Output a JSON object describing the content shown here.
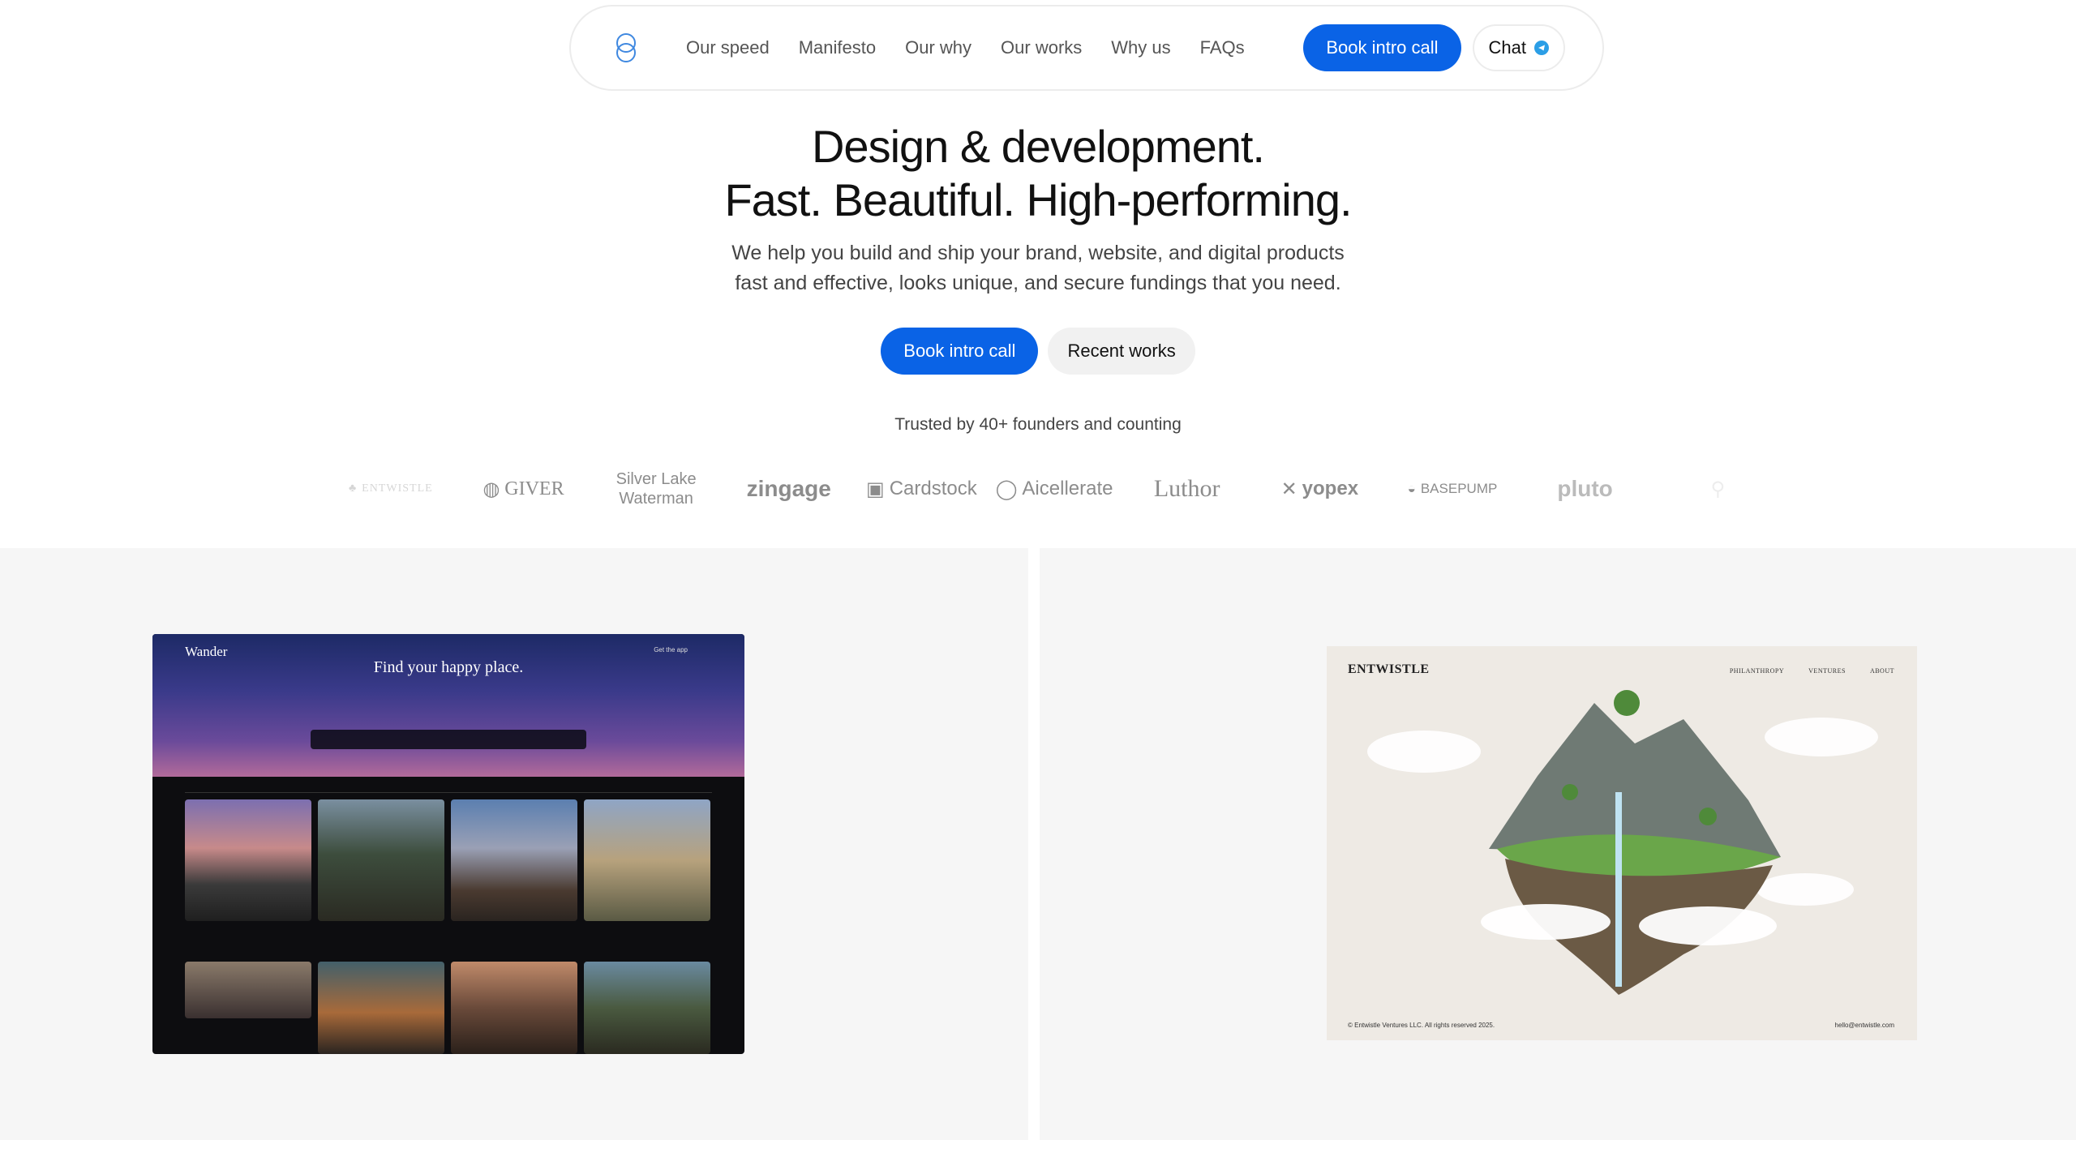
{
  "nav": {
    "links": [
      "Our speed",
      "Manifesto",
      "Our why",
      "Our works",
      "Why us",
      "FAQs"
    ],
    "book_label": "Book intro call",
    "chat_label": "Chat"
  },
  "hero": {
    "title_line1": "Design & development.",
    "title_line2": "Fast. Beautiful. High-performing.",
    "subtitle_line1": "We help you build and ship your brand, website, and digital products",
    "subtitle_line2": "fast and effective, looks unique, and secure fundings that you need.",
    "cta_primary": "Book intro call",
    "cta_secondary": "Recent works"
  },
  "trusted": {
    "text": "Trusted by 40+ founders and counting",
    "logos": [
      "ENTWISTLE",
      "GIVER",
      "Silver Lake Waterman",
      "zingage",
      "Cardstock",
      "Aicellerate",
      "Luthor",
      "yopex",
      "BASEPUMP",
      "pluto"
    ]
  },
  "showcase": {
    "wander": {
      "brand": "Wander",
      "tagline": "Find your happy place.",
      "get_app": "Get the app"
    },
    "entwistle": {
      "brand": "ENTWISTLE",
      "nav": [
        "PHILANTHROPY",
        "VENTURES",
        "ABOUT"
      ],
      "footer_left": "© Entwistle Ventures LLC. All rights reserved 2025.",
      "footer_right": "hello@entwistle.com"
    }
  },
  "colors": {
    "accent": "#0a63e6",
    "chat_dot": "#2b9ee6",
    "panel_bg": "#f6f6f6"
  }
}
